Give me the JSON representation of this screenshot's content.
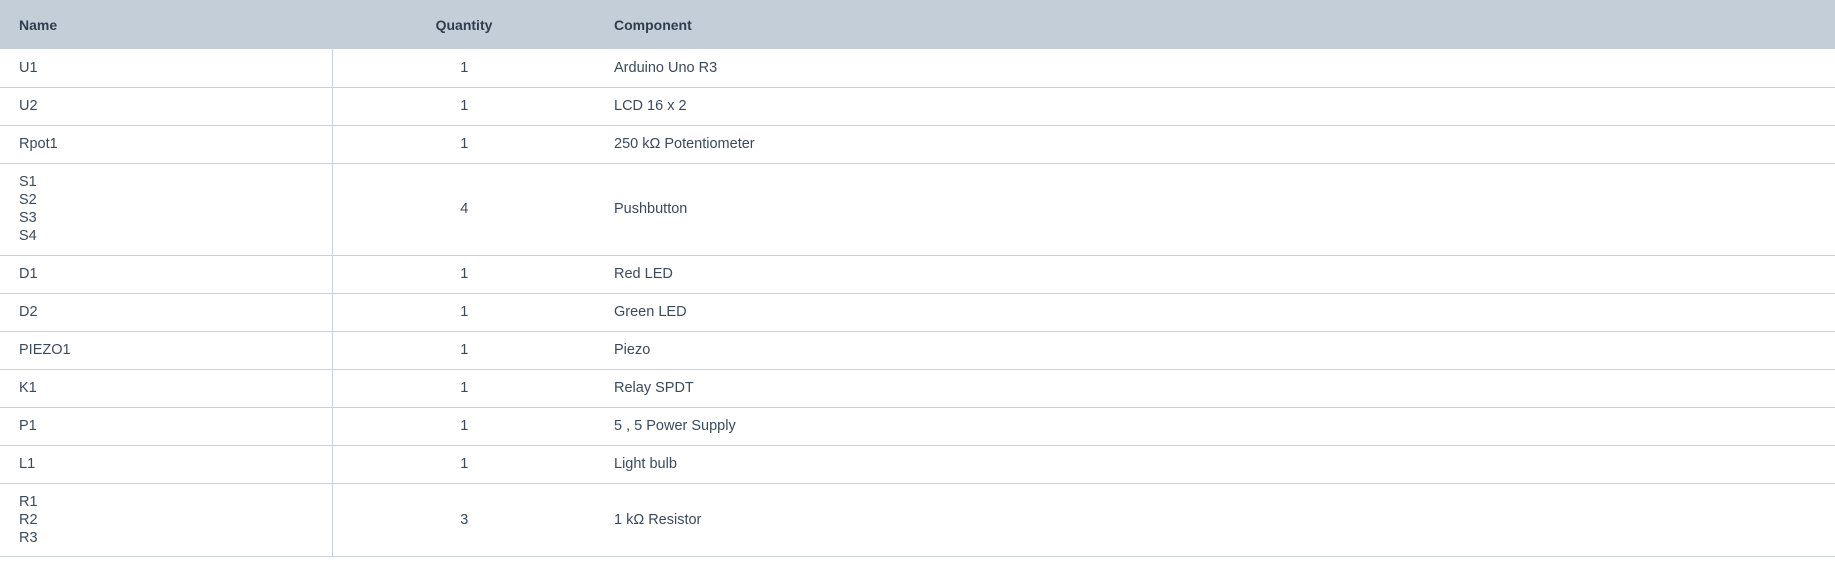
{
  "table": {
    "headers": {
      "name": "Name",
      "quantity": "Quantity",
      "component": "Component"
    },
    "rows": [
      {
        "names": [
          "U1"
        ],
        "quantity": "1",
        "component": "Arduino Uno R3"
      },
      {
        "names": [
          "U2"
        ],
        "quantity": "1",
        "component": "LCD 16 x 2"
      },
      {
        "names": [
          "Rpot1"
        ],
        "quantity": "1",
        "component": "250 kΩ Potentiometer"
      },
      {
        "names": [
          "S1",
          "S2",
          "S3",
          "S4"
        ],
        "quantity": "4",
        "component": "Pushbutton"
      },
      {
        "names": [
          "D1"
        ],
        "quantity": "1",
        "component": "Red LED"
      },
      {
        "names": [
          "D2"
        ],
        "quantity": "1",
        "component": "Green LED"
      },
      {
        "names": [
          "PIEZO1"
        ],
        "quantity": "1",
        "component": "Piezo"
      },
      {
        "names": [
          "K1"
        ],
        "quantity": "1",
        "component": "Relay SPDT"
      },
      {
        "names": [
          "P1"
        ],
        "quantity": "1",
        "component": "5 , 5 Power Supply"
      },
      {
        "names": [
          "L1"
        ],
        "quantity": "1",
        "component": "Light bulb"
      },
      {
        "names": [
          "R1",
          "R2",
          "R3"
        ],
        "quantity": "3",
        "component": "1 kΩ Resistor"
      }
    ]
  }
}
